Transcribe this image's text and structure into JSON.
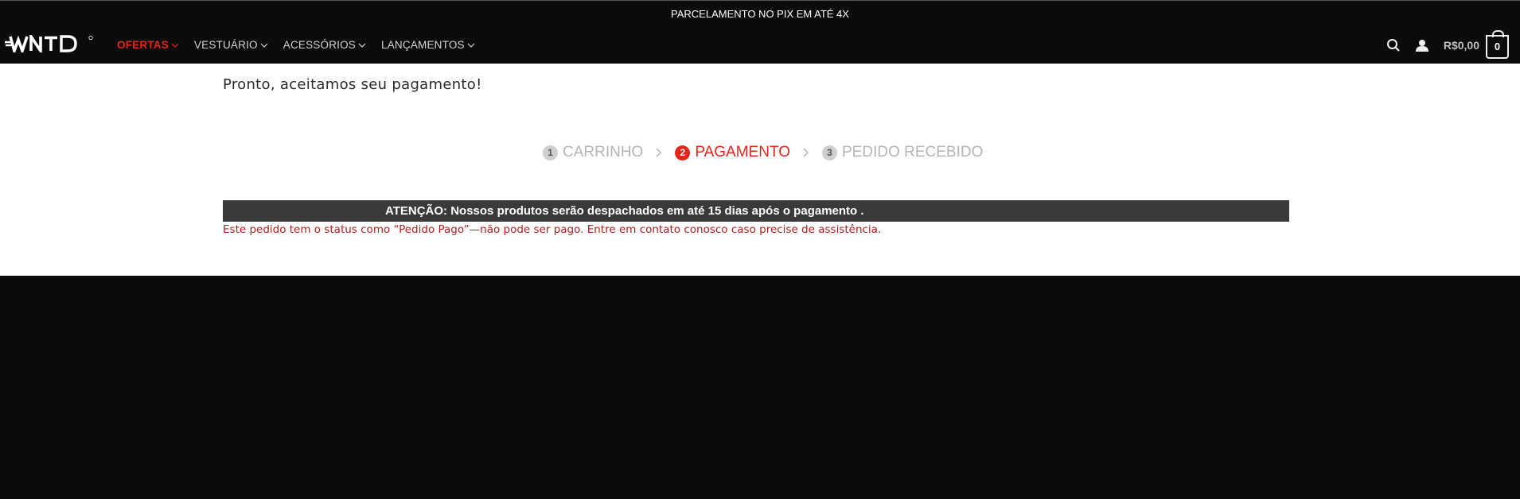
{
  "topbar": {
    "text": "PARCELAMENTO NO PIX EM ATÉ 4X"
  },
  "header": {
    "logo_text": "WNTD",
    "nav": [
      {
        "label": "OFERTAS",
        "active": true
      },
      {
        "label": "VESTUÁRIO",
        "active": false
      },
      {
        "label": "ACESSÓRIOS",
        "active": false
      },
      {
        "label": "LANÇAMENTOS",
        "active": false
      }
    ],
    "cart_total": "R$0,00",
    "cart_count": "0"
  },
  "main": {
    "confirmation": "Pronto, aceitamos seu pagamento!",
    "steps": [
      {
        "num": "1",
        "label": "CARRINHO"
      },
      {
        "num": "2",
        "label": "PAGAMENTO"
      },
      {
        "num": "3",
        "label": "PEDIDO RECEBIDO"
      }
    ],
    "notice": "ATENÇÃO: Nossos produtos serão despachados em até 15 dias após o pagamento .",
    "status_note": "Este pedido tem o status como “Pedido Pago”—não pode ser pago. Entre em contato conosco caso precise de assistência."
  },
  "colors": {
    "accent": "#e3261b",
    "background": "#0b0b0b",
    "notice_bar": "#3a3a3a",
    "error_text": "#b01e1e"
  }
}
